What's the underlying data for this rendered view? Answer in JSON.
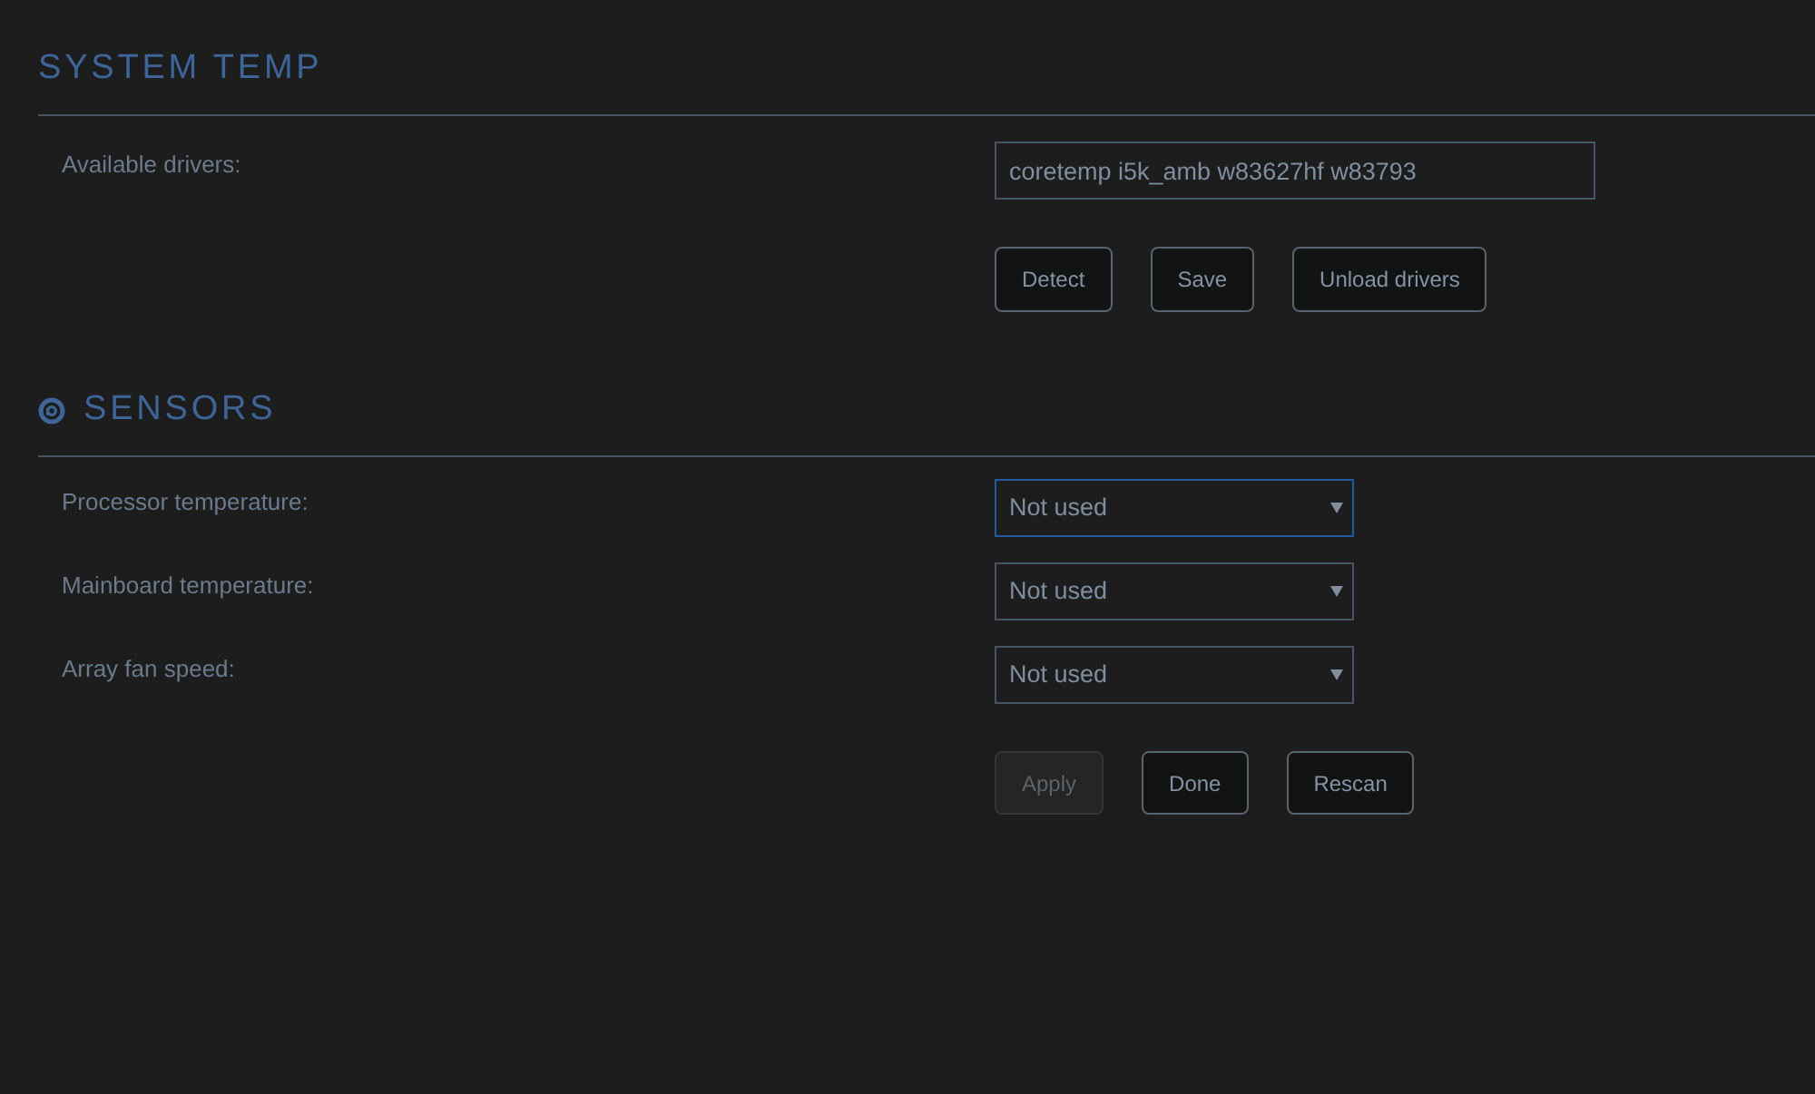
{
  "system_temp": {
    "title": "SYSTEM TEMP",
    "drivers_label": "Available drivers:",
    "drivers_value": "coretemp i5k_amb w83627hf w83793",
    "buttons": [
      {
        "label": "Detect",
        "disabled": false
      },
      {
        "label": "Save",
        "disabled": false
      },
      {
        "label": "Unload drivers",
        "disabled": false
      }
    ]
  },
  "sensors": {
    "title": "SENSORS",
    "rows": [
      {
        "label": "Processor temperature:",
        "value": "Not used",
        "focused": true
      },
      {
        "label": "Mainboard temperature:",
        "value": "Not used",
        "focused": false
      },
      {
        "label": "Array fan speed:",
        "value": "Not used",
        "focused": false
      }
    ],
    "buttons": [
      {
        "label": "Apply",
        "disabled": true
      },
      {
        "label": "Done",
        "disabled": false
      },
      {
        "label": "Rescan",
        "disabled": false
      }
    ]
  }
}
